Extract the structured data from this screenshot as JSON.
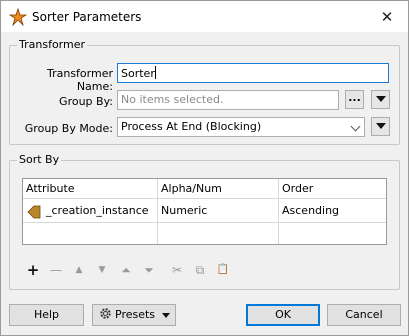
{
  "window": {
    "title": "Sorter Parameters",
    "close_symbol": "✕"
  },
  "transformer": {
    "section_label": "Transformer",
    "name_label": "Transformer Name:",
    "name_value": "Sorter",
    "group_by_label": "Group By:",
    "group_by_placeholder": "No items selected.",
    "group_by_button": "...",
    "group_by_mode_label": "Group By Mode:",
    "group_by_mode_value": "Process At End (Blocking)"
  },
  "sort_by": {
    "section_label": "Sort By",
    "columns": [
      "Attribute",
      "Alpha/Num",
      "Order"
    ],
    "rows": [
      {
        "attribute": "_creation_instance",
        "alpha_num": "Numeric",
        "order": "Ascending"
      }
    ]
  },
  "toolbar": {
    "add": "+",
    "remove": "—",
    "move_up": "▲",
    "move_down": "▼",
    "move_top": "⏶",
    "move_bottom": "⏷",
    "cut": "✂",
    "copy": "⧉",
    "paste": "📋"
  },
  "footer": {
    "help": "Help",
    "presets": "Presets",
    "ok": "OK",
    "cancel": "Cancel"
  }
}
